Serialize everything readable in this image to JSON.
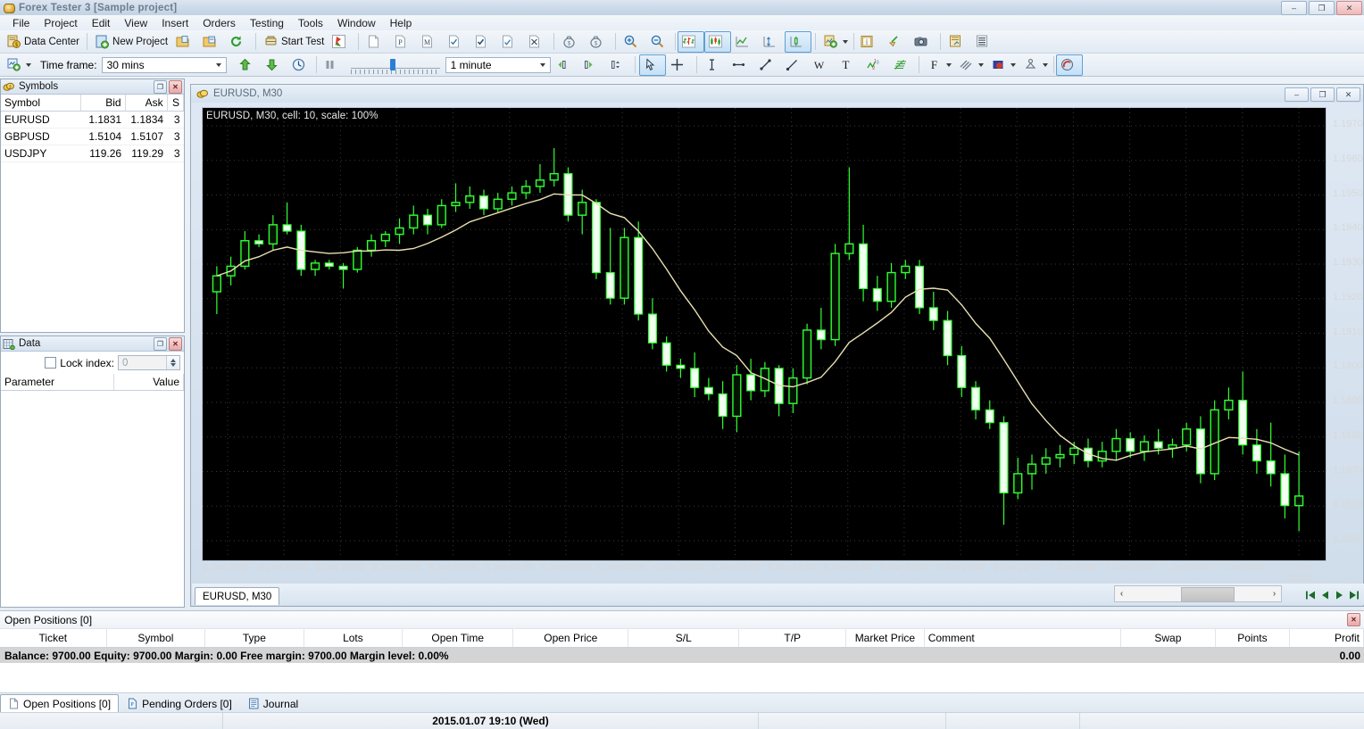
{
  "window": {
    "title": "Forex Tester 3  [Sample project]",
    "app_icon": "coins-icon",
    "controls": {
      "minimize": "–",
      "restore": "❐",
      "close": "✕"
    }
  },
  "menu": {
    "items": [
      "File",
      "Project",
      "Edit",
      "View",
      "Insert",
      "Orders",
      "Testing",
      "Tools",
      "Window",
      "Help"
    ]
  },
  "toolbar_main": {
    "data_center": "Data Center",
    "new_project": "New Project",
    "start_test": "Start Test"
  },
  "toolbar_chart": {
    "timeframe_label": "Time frame:",
    "timeframe_value": "30 mins",
    "speed_value": "1 minute"
  },
  "symbols_panel": {
    "title": "Symbols",
    "icon": "coins-icon",
    "columns": [
      "Symbol",
      "Bid",
      "Ask",
      "S"
    ],
    "rows": [
      {
        "symbol": "EURUSD",
        "bid": "1.1831",
        "ask": "1.1834",
        "s": "3"
      },
      {
        "symbol": "GBPUSD",
        "bid": "1.5104",
        "ask": "1.5107",
        "s": "3"
      },
      {
        "symbol": "USDJPY",
        "bid": "119.26",
        "ask": "119.29",
        "s": "3"
      }
    ]
  },
  "data_panel": {
    "title": "Data",
    "icon": "data-grid-icon",
    "lock_index_label": "Lock index:",
    "lock_index_value": "0",
    "columns": [
      "Parameter",
      "Value"
    ]
  },
  "chart_window": {
    "tab_icon": "coins-icon",
    "title": "EURUSD, M30",
    "overlay_label": "EURUSD, M30, cell: 10, scale: 100%",
    "tab_label": "EURUSD, M30",
    "controls": {
      "minimize": "–",
      "restore": "❐",
      "close": "✕"
    }
  },
  "chart_data": {
    "type": "candlestick",
    "title": "EURUSD, M30, cell: 10, scale: 100%",
    "symbol": "EURUSD",
    "timeframe": "M30",
    "xlabel": "",
    "ylabel": "",
    "ylim": [
      1.1845,
      1.1975
    ],
    "grid": true,
    "legend": "none",
    "background": "#000000",
    "bull_color": "#33ff33",
    "bear_color": "#ffffff",
    "ma_color": "#e8e0b0",
    "price_ticks": [
      "1.1970",
      "1.1960",
      "1.1950",
      "1.1940",
      "1.1930",
      "1.1920",
      "1.1910",
      "1.1900",
      "1.1890",
      "1.1880",
      "1.1870",
      "1.1860",
      "1.1850"
    ],
    "time_ticks": [
      "5 Jan 2015",
      "5 Jan 20:00",
      "5 Jan 22:00",
      "6 Jan 00:00",
      "6 Jan 02:00",
      "6 Jan 04:00",
      "6 Jan 06:00",
      "6 Jan 08:00",
      "6 Jan 10:00",
      "6 Jan 12:00",
      "6 Jan 14:00",
      "6 Jan 16:00",
      "6 Jan 18:00",
      "6 Jan 20:00",
      "6 Jan 22:00",
      "7 Jan 00:00",
      "7 Jan 02:00",
      "7 Jan 04:00",
      "7 Jan 06:00",
      "7 Jan 08:00"
    ],
    "candles": [
      {
        "o": 1.1923,
        "h": 1.1931,
        "l": 1.1916,
        "c": 1.1928
      },
      {
        "o": 1.1928,
        "h": 1.1934,
        "l": 1.1925,
        "c": 1.1931
      },
      {
        "o": 1.1931,
        "h": 1.1942,
        "l": 1.193,
        "c": 1.1939
      },
      {
        "o": 1.1939,
        "h": 1.1941,
        "l": 1.1937,
        "c": 1.1938
      },
      {
        "o": 1.1938,
        "h": 1.1947,
        "l": 1.1936,
        "c": 1.1944
      },
      {
        "o": 1.1944,
        "h": 1.1951,
        "l": 1.1941,
        "c": 1.1942
      },
      {
        "o": 1.1942,
        "h": 1.1944,
        "l": 1.1928,
        "c": 1.193
      },
      {
        "o": 1.193,
        "h": 1.1933,
        "l": 1.1928,
        "c": 1.1932
      },
      {
        "o": 1.1932,
        "h": 1.1933,
        "l": 1.193,
        "c": 1.1931
      },
      {
        "o": 1.1931,
        "h": 1.1932,
        "l": 1.1924,
        "c": 1.193
      },
      {
        "o": 1.193,
        "h": 1.1937,
        "l": 1.1929,
        "c": 1.1936
      },
      {
        "o": 1.1936,
        "h": 1.1941,
        "l": 1.1934,
        "c": 1.1939
      },
      {
        "o": 1.1939,
        "h": 1.1942,
        "l": 1.1937,
        "c": 1.1941
      },
      {
        "o": 1.1941,
        "h": 1.1946,
        "l": 1.1938,
        "c": 1.1943
      },
      {
        "o": 1.1943,
        "h": 1.195,
        "l": 1.1941,
        "c": 1.1947
      },
      {
        "o": 1.1947,
        "h": 1.1949,
        "l": 1.1941,
        "c": 1.1944
      },
      {
        "o": 1.1944,
        "h": 1.1952,
        "l": 1.1943,
        "c": 1.195
      },
      {
        "o": 1.195,
        "h": 1.1957,
        "l": 1.1948,
        "c": 1.1951
      },
      {
        "o": 1.1951,
        "h": 1.1956,
        "l": 1.1949,
        "c": 1.1953
      },
      {
        "o": 1.1953,
        "h": 1.1955,
        "l": 1.1947,
        "c": 1.1949
      },
      {
        "o": 1.1949,
        "h": 1.1954,
        "l": 1.1948,
        "c": 1.1952
      },
      {
        "o": 1.1952,
        "h": 1.1956,
        "l": 1.195,
        "c": 1.1954
      },
      {
        "o": 1.1954,
        "h": 1.1958,
        "l": 1.1952,
        "c": 1.1956
      },
      {
        "o": 1.1956,
        "h": 1.1963,
        "l": 1.1954,
        "c": 1.1958
      },
      {
        "o": 1.1958,
        "h": 1.1968,
        "l": 1.1956,
        "c": 1.196
      },
      {
        "o": 1.196,
        "h": 1.1962,
        "l": 1.1945,
        "c": 1.1947
      },
      {
        "o": 1.1947,
        "h": 1.1955,
        "l": 1.1941,
        "c": 1.1951
      },
      {
        "o": 1.1951,
        "h": 1.1952,
        "l": 1.1927,
        "c": 1.1929
      },
      {
        "o": 1.1929,
        "h": 1.1943,
        "l": 1.1919,
        "c": 1.1921
      },
      {
        "o": 1.1921,
        "h": 1.1943,
        "l": 1.1919,
        "c": 1.194
      },
      {
        "o": 1.194,
        "h": 1.1945,
        "l": 1.1914,
        "c": 1.1916
      },
      {
        "o": 1.1916,
        "h": 1.1921,
        "l": 1.1905,
        "c": 1.1907
      },
      {
        "o": 1.1907,
        "h": 1.1909,
        "l": 1.1898,
        "c": 1.19
      },
      {
        "o": 1.19,
        "h": 1.1902,
        "l": 1.1896,
        "c": 1.1899
      },
      {
        "o": 1.1899,
        "h": 1.1904,
        "l": 1.189,
        "c": 1.1893
      },
      {
        "o": 1.1893,
        "h": 1.1896,
        "l": 1.1889,
        "c": 1.1891
      },
      {
        "o": 1.1891,
        "h": 1.1895,
        "l": 1.188,
        "c": 1.1884
      },
      {
        "o": 1.1884,
        "h": 1.19,
        "l": 1.1879,
        "c": 1.1897
      },
      {
        "o": 1.1897,
        "h": 1.1902,
        "l": 1.1889,
        "c": 1.1892
      },
      {
        "o": 1.1892,
        "h": 1.1901,
        "l": 1.189,
        "c": 1.1899
      },
      {
        "o": 1.1899,
        "h": 1.19,
        "l": 1.1884,
        "c": 1.1888
      },
      {
        "o": 1.1888,
        "h": 1.1899,
        "l": 1.1885,
        "c": 1.1896
      },
      {
        "o": 1.1896,
        "h": 1.1913,
        "l": 1.1894,
        "c": 1.1911
      },
      {
        "o": 1.1911,
        "h": 1.1918,
        "l": 1.1905,
        "c": 1.1908
      },
      {
        "o": 1.1908,
        "h": 1.1938,
        "l": 1.1906,
        "c": 1.1935
      },
      {
        "o": 1.1935,
        "h": 1.1962,
        "l": 1.1933,
        "c": 1.1938
      },
      {
        "o": 1.1938,
        "h": 1.1944,
        "l": 1.192,
        "c": 1.1924
      },
      {
        "o": 1.1924,
        "h": 1.1928,
        "l": 1.1917,
        "c": 1.192
      },
      {
        "o": 1.192,
        "h": 1.1932,
        "l": 1.1918,
        "c": 1.1929
      },
      {
        "o": 1.1929,
        "h": 1.1933,
        "l": 1.1927,
        "c": 1.1931
      },
      {
        "o": 1.1931,
        "h": 1.1933,
        "l": 1.1916,
        "c": 1.1918
      },
      {
        "o": 1.1918,
        "h": 1.1923,
        "l": 1.1911,
        "c": 1.1914
      },
      {
        "o": 1.1914,
        "h": 1.1917,
        "l": 1.19,
        "c": 1.1903
      },
      {
        "o": 1.1903,
        "h": 1.1906,
        "l": 1.189,
        "c": 1.1893
      },
      {
        "o": 1.1893,
        "h": 1.1895,
        "l": 1.1883,
        "c": 1.1886
      },
      {
        "o": 1.1886,
        "h": 1.1889,
        "l": 1.188,
        "c": 1.1882
      },
      {
        "o": 1.1882,
        "h": 1.1884,
        "l": 1.185,
        "c": 1.186
      },
      {
        "o": 1.186,
        "h": 1.1871,
        "l": 1.1858,
        "c": 1.1866
      },
      {
        "o": 1.1866,
        "h": 1.1872,
        "l": 1.1861,
        "c": 1.1869
      },
      {
        "o": 1.1869,
        "h": 1.1874,
        "l": 1.1866,
        "c": 1.1871
      },
      {
        "o": 1.1871,
        "h": 1.1875,
        "l": 1.1868,
        "c": 1.1872
      },
      {
        "o": 1.1872,
        "h": 1.1876,
        "l": 1.1869,
        "c": 1.1874
      },
      {
        "o": 1.1874,
        "h": 1.1877,
        "l": 1.1868,
        "c": 1.187
      },
      {
        "o": 1.187,
        "h": 1.1876,
        "l": 1.1868,
        "c": 1.1873
      },
      {
        "o": 1.1873,
        "h": 1.188,
        "l": 1.187,
        "c": 1.1877
      },
      {
        "o": 1.1877,
        "h": 1.1879,
        "l": 1.1871,
        "c": 1.1873
      },
      {
        "o": 1.1873,
        "h": 1.1878,
        "l": 1.187,
        "c": 1.1876
      },
      {
        "o": 1.1876,
        "h": 1.188,
        "l": 1.1872,
        "c": 1.1874
      },
      {
        "o": 1.1874,
        "h": 1.1877,
        "l": 1.1871,
        "c": 1.1875
      },
      {
        "o": 1.1875,
        "h": 1.1882,
        "l": 1.1873,
        "c": 1.188
      },
      {
        "o": 1.188,
        "h": 1.1884,
        "l": 1.1863,
        "c": 1.1866
      },
      {
        "o": 1.1866,
        "h": 1.1889,
        "l": 1.1864,
        "c": 1.1886
      },
      {
        "o": 1.1886,
        "h": 1.1893,
        "l": 1.1883,
        "c": 1.1889
      },
      {
        "o": 1.1889,
        "h": 1.1898,
        "l": 1.1872,
        "c": 1.1875
      },
      {
        "o": 1.1875,
        "h": 1.188,
        "l": 1.1866,
        "c": 1.187
      },
      {
        "o": 1.187,
        "h": 1.1882,
        "l": 1.1862,
        "c": 1.1866
      },
      {
        "o": 1.1866,
        "h": 1.1872,
        "l": 1.1852,
        "c": 1.1856
      },
      {
        "o": 1.1856,
        "h": 1.1873,
        "l": 1.1848,
        "c": 1.1859
      }
    ]
  },
  "open_positions": {
    "header": "Open Positions [0]",
    "close_icon": "close-icon",
    "columns": [
      "Ticket",
      "Symbol",
      "Type",
      "Lots",
      "Open Time",
      "Open Price",
      "S/L",
      "T/P",
      "Market Price",
      "Comment",
      "Swap",
      "Points",
      "Profit"
    ],
    "balance_line": "Balance: 9700.00 Equity: 9700.00 Margin: 0.00 Free margin: 9700.00 Margin level: 0.00%",
    "profit_value": "0.00"
  },
  "bottom_tabs": {
    "items": [
      {
        "label": "Open Positions [0]",
        "icon": "document-icon",
        "active": true
      },
      {
        "label": "Pending Orders [0]",
        "icon": "pending-order-icon",
        "active": false
      },
      {
        "label": "Journal",
        "icon": "journal-icon",
        "active": false
      }
    ]
  },
  "status_bar": {
    "datetime": "2015.01.07 19:10 (Wed)"
  }
}
